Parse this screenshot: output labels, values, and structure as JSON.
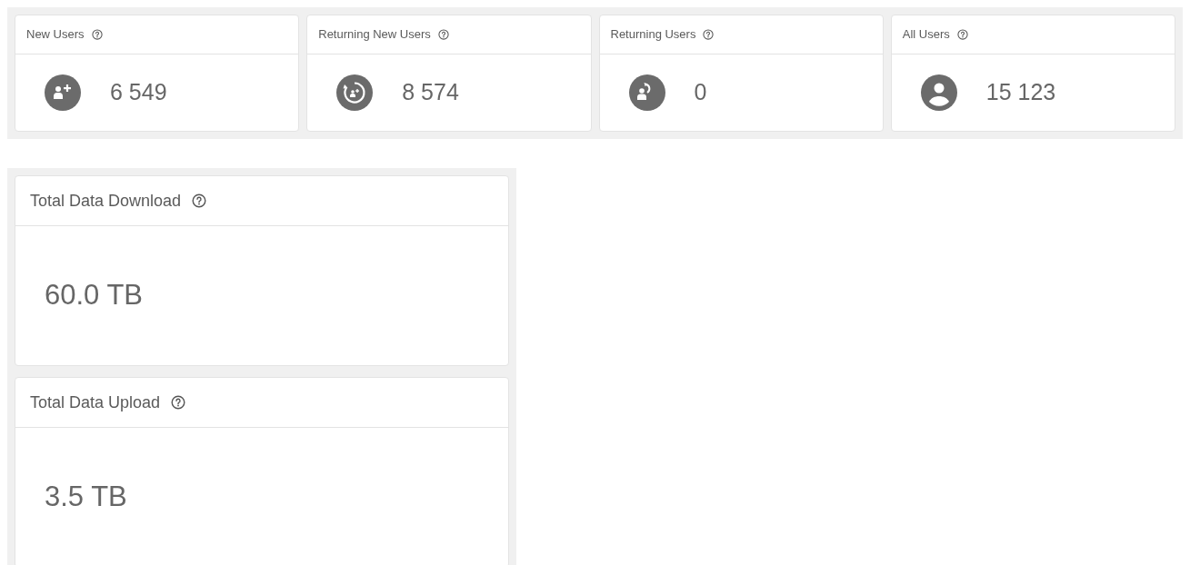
{
  "user_stats": [
    {
      "title": "New Users",
      "kind": "user-plus",
      "value": "6 549"
    },
    {
      "title": "Returning New Users",
      "kind": "user-cycle",
      "value": "8 574"
    },
    {
      "title": "Returning Users",
      "kind": "user-return",
      "value": "0"
    },
    {
      "title": "All Users",
      "kind": "user",
      "value": "15 123"
    }
  ],
  "data_stats": [
    {
      "title": "Total Data Download",
      "value": "60.0 TB"
    },
    {
      "title": "Total Data Upload",
      "value": "3.5 TB"
    }
  ]
}
